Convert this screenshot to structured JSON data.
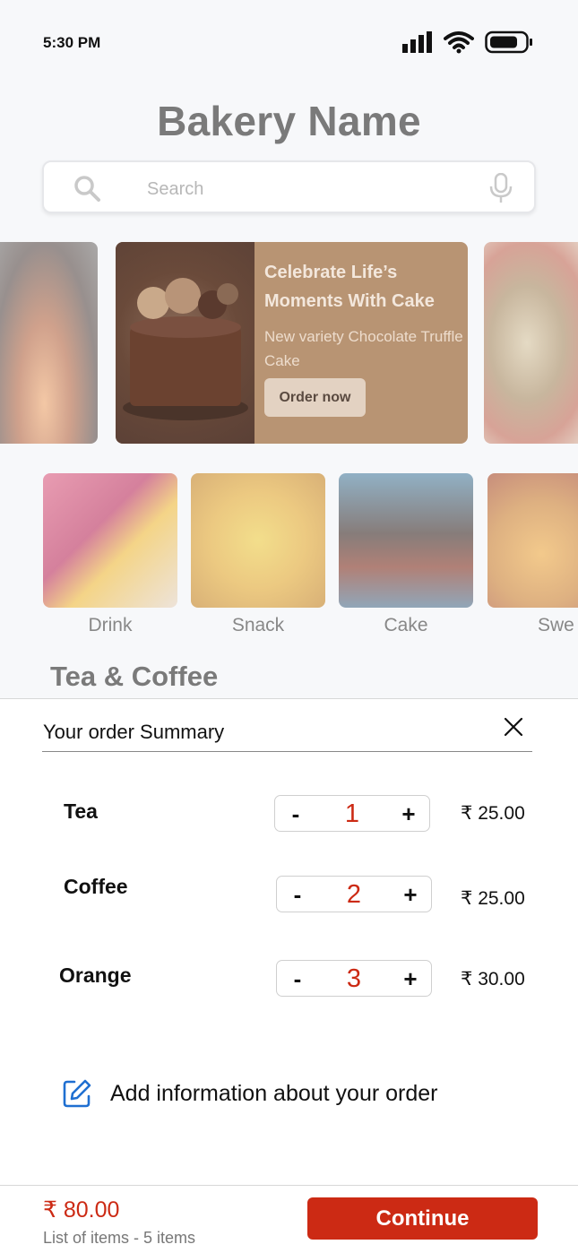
{
  "status_bar": {
    "time": "5:30 PM",
    "icons": [
      "signal-icon",
      "wifi-icon",
      "battery-icon"
    ]
  },
  "header": {
    "title": "Bakery Name"
  },
  "search": {
    "placeholder": "Search",
    "icons": [
      "search-icon",
      "microphone-icon"
    ]
  },
  "banner": {
    "title": "Celebrate Life’s Moments With Cake",
    "subtitle": "New variety Chocolate Truffle Cake",
    "button_label": "Order now"
  },
  "categories": [
    {
      "label": "Drink"
    },
    {
      "label": "Snack"
    },
    {
      "label": "Cake"
    },
    {
      "label": "Swe"
    }
  ],
  "section": {
    "title": "Tea & Coffee"
  },
  "order_summary": {
    "title": "Your order Summary",
    "items": [
      {
        "name": "Tea",
        "qty": "1",
        "price": "₹ 25.00"
      },
      {
        "name": "Coffee",
        "qty": "2",
        "price": "₹ 25.00"
      },
      {
        "name": "Orange",
        "qty": "3",
        "price": "₹ 30.00"
      }
    ],
    "minus_label": "-",
    "plus_label": "+",
    "add_info_label": "Add information about your order"
  },
  "footer": {
    "total": "₹  80.00",
    "subtitle": "List of items - 5 items",
    "continue_label": "Continue"
  },
  "colors": {
    "accent": "#cc2a14",
    "banner_bg": "#b89473",
    "edit_icon": "#1f6fd1"
  }
}
